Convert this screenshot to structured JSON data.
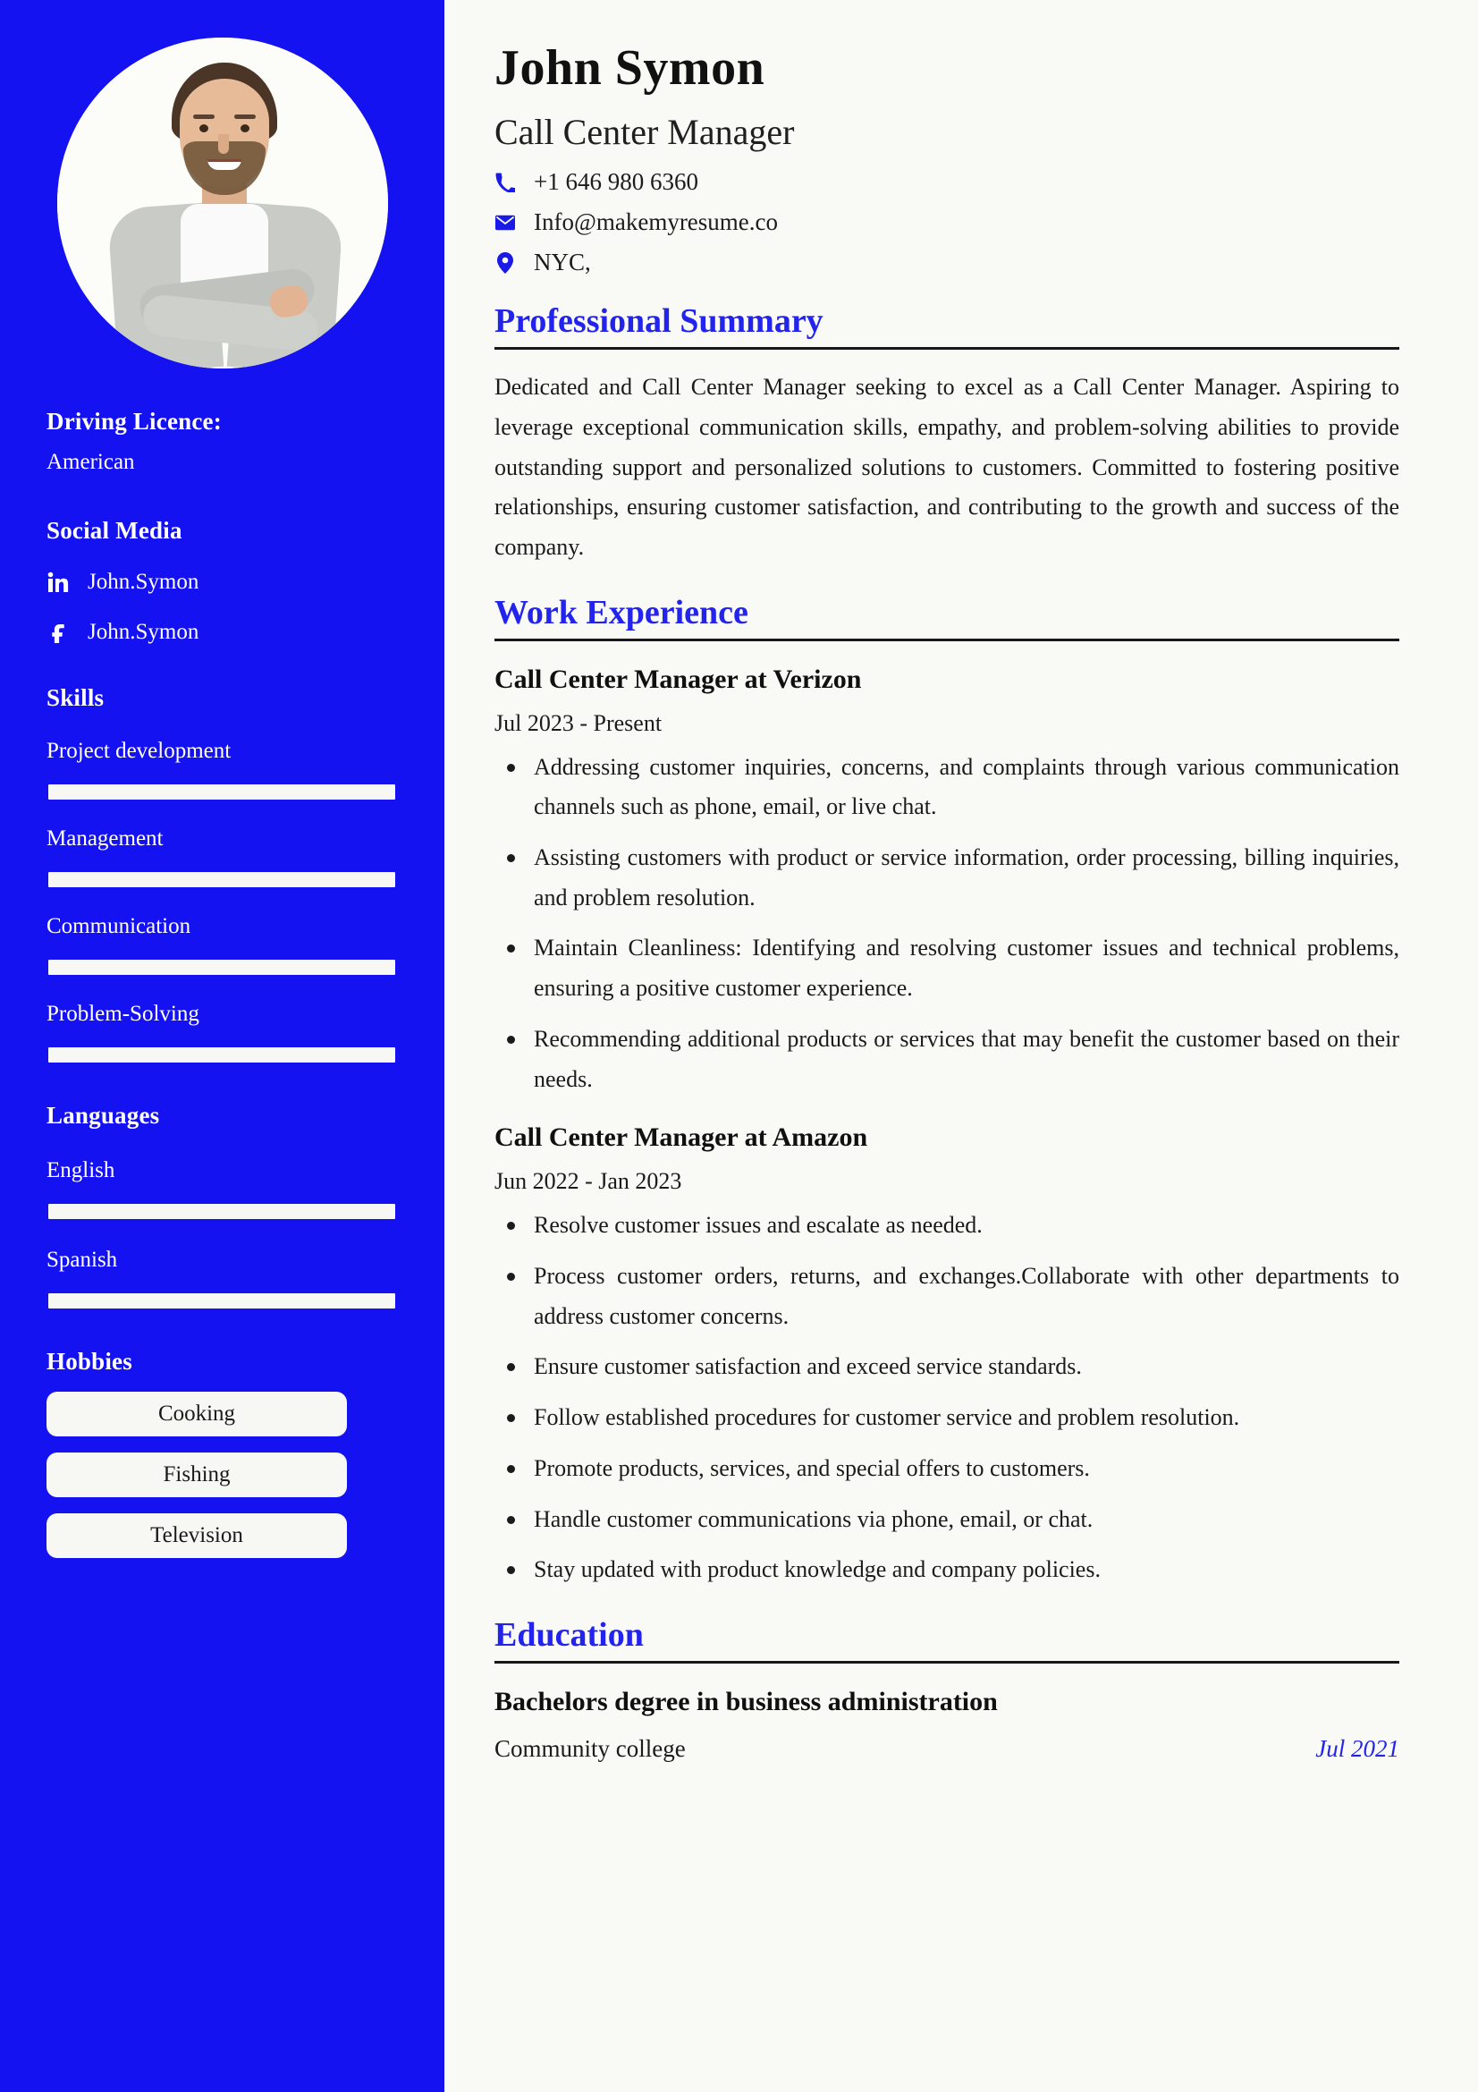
{
  "colors": {
    "sidebar_bg": "#1512f2",
    "accent_blue": "#2323ee",
    "page_bg": "#f9faf6",
    "text_dark": "#1b1b1b",
    "pill_bg": "#f7f8f3"
  },
  "sidebar": {
    "photo_alt": "profile-photo",
    "driving_licence": {
      "heading": "Driving Licence:",
      "value": "American"
    },
    "social_media": {
      "heading": "Social Media",
      "items": [
        {
          "icon": "linkedin-icon",
          "label": "John.Symon"
        },
        {
          "icon": "facebook-icon",
          "label": "John.Symon"
        }
      ]
    },
    "skills": {
      "heading": "Skills",
      "items": [
        {
          "label": "Project development",
          "level": 100
        },
        {
          "label": "Management",
          "level": 100
        },
        {
          "label": "Communication",
          "level": 100
        },
        {
          "label": "Problem-Solving",
          "level": 100
        }
      ]
    },
    "languages": {
      "heading": "Languages",
      "items": [
        {
          "label": "English",
          "level": 100
        },
        {
          "label": "Spanish",
          "level": 100
        }
      ]
    },
    "hobbies": {
      "heading": "Hobbies",
      "items": [
        {
          "label": "Cooking"
        },
        {
          "label": "Fishing"
        },
        {
          "label": "Television"
        }
      ]
    }
  },
  "header": {
    "name": "John Symon",
    "job_title": "Call Center Manager",
    "contacts": [
      {
        "icon": "phone-icon",
        "value": "+1 646 980 6360"
      },
      {
        "icon": "email-icon",
        "value": "Info@makemyresume.co"
      },
      {
        "icon": "location-pin-icon",
        "value": "NYC,"
      }
    ]
  },
  "sections": {
    "summary": {
      "heading": "Professional Summary",
      "text": "Dedicated and Call Center Manager seeking to excel as a Call Center Manager. Aspiring to leverage exceptional communication skills, empathy, and problem-solving abilities to provide outstanding support and personalized solutions to customers. Committed to fostering positive relationships, ensuring customer satisfaction, and contributing to the growth and success of the company."
    },
    "work_experience": {
      "heading": "Work Experience",
      "jobs": [
        {
          "title": "Call Center Manager at Verizon",
          "dates": "Jul 2023 - Present",
          "bullets": [
            "Addressing customer inquiries, concerns, and complaints through various communication channels such as phone, email, or live chat.",
            "Assisting customers with product or service information, order processing, billing inquiries, and problem resolution.",
            "Maintain Cleanliness: Identifying and resolving customer issues and technical problems, ensuring a positive customer experience.",
            "Recommending additional products or services that may benefit the customer based on their needs."
          ]
        },
        {
          "title": "Call Center Manager at Amazon",
          "dates": "Jun 2022 - Jan 2023",
          "bullets": [
            "Resolve customer issues and escalate as needed.",
            "Process customer orders, returns, and exchanges.Collaborate with other departments to address customer concerns.",
            "Ensure customer satisfaction and exceed service standards.",
            "Follow established procedures for customer service and problem resolution.",
            "Promote products, services, and special offers to customers.",
            "Handle customer communications via phone, email, or chat.",
            "Stay updated with product knowledge and company policies."
          ]
        }
      ]
    },
    "education": {
      "heading": "Education",
      "entries": [
        {
          "degree": "Bachelors degree in business administration",
          "school": "Community college",
          "date": "Jul 2021"
        }
      ]
    }
  }
}
